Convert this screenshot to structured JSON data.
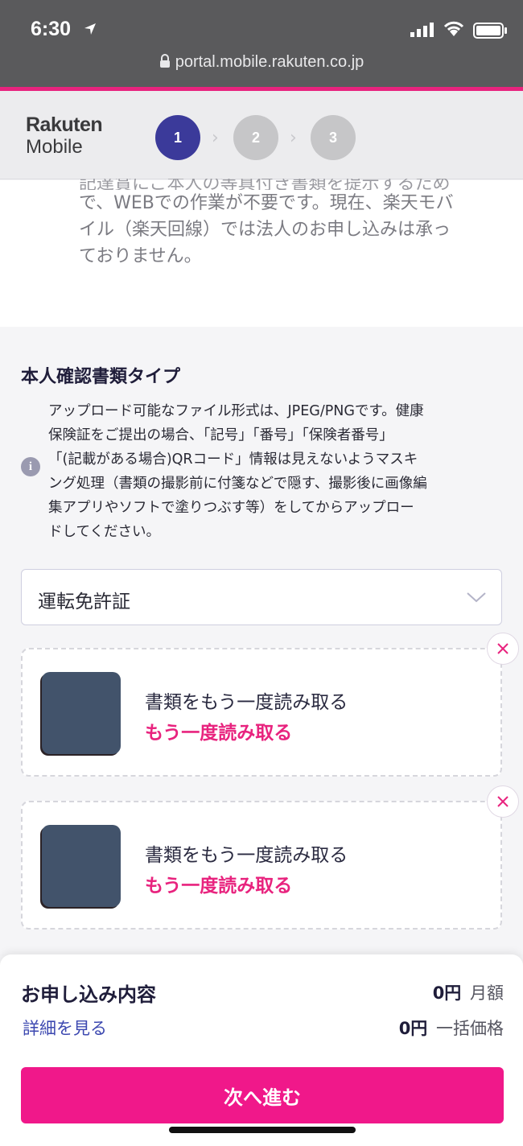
{
  "status_bar": {
    "time": "6:30",
    "url": "portal.mobile.rakuten.co.jp"
  },
  "header": {
    "logo_top": "Rakuten",
    "logo_bottom": "Mobile",
    "steps": [
      "1",
      "2",
      "3"
    ],
    "active_step": 1
  },
  "intro": {
    "cut_line": "記達賞にご本人の等真付き書類を提示するため",
    "lines": [
      "で、WEBでの作業が不要です。現在、楽天モバ",
      "イル（楽天回線）では法人のお申し込みは承っ",
      "ておりません。"
    ]
  },
  "id_section": {
    "title": "本人確認書類タイプ",
    "info_lines": [
      "アップロード可能なファイル形式は、JPEG/PNGです。健康",
      "保険証をご提出の場合、「記号」「番号」「保険者番号」",
      "「(記載がある場合)QRコード」情報は見えないようマスキ",
      "ング処理（書類の撮影前に付箋などで隠す、撮影後に画像編",
      "集アプリやソフトで塗りつぶす等）をしてからアップロー",
      "ドしてください。"
    ],
    "document_type": "運転免許証"
  },
  "uploads": [
    {
      "title": "書類をもう一度読み取る",
      "link": "もう一度読み取る"
    },
    {
      "title": "書類をもう一度読み取る",
      "link": "もう一度読み取る"
    }
  ],
  "summary": {
    "title": "お申し込み内容",
    "detail_link": "詳細を見る",
    "monthly_amount": "0円",
    "monthly_label": "月額",
    "oneoff_amount": "0円",
    "oneoff_label": "一括価格",
    "next_button": "次へ進む"
  },
  "colors": {
    "accent_pink": "#e8237e",
    "button_pink": "#f0188a",
    "step_active": "#3b3a9a",
    "step_inactive": "#c6c6c8",
    "link_blue": "#3c48b0"
  }
}
